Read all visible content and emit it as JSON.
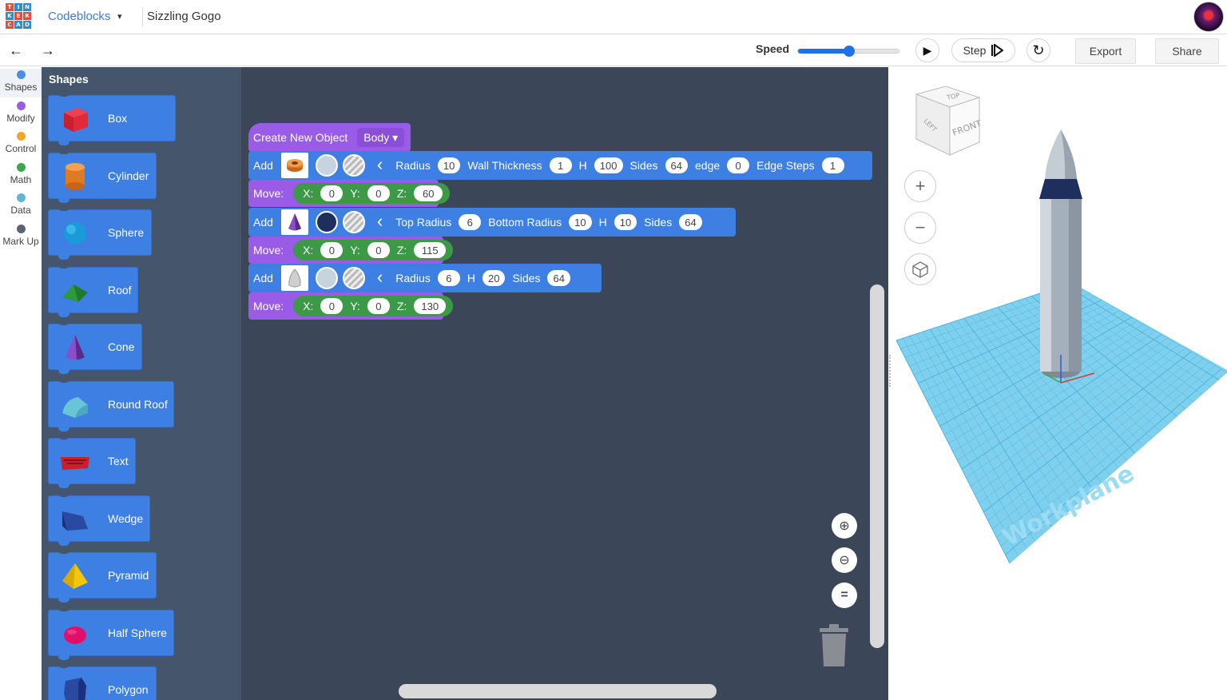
{
  "header": {
    "logo_letters": [
      "T",
      "I",
      "N",
      "K",
      "E",
      "R",
      "C",
      "A",
      "D"
    ],
    "logo_colors": [
      "#e64c3c",
      "#2a8fcf",
      "#2a8fcf",
      "#2a8fcf",
      "#e64c3c",
      "#e64c3c",
      "#e64c3c",
      "#2a8fcf",
      "#2a8fcf"
    ],
    "app_name": "Codeblocks",
    "app_caret": "▾",
    "project_name": "Sizzling Gogo"
  },
  "toolbar": {
    "undo_icon": "←",
    "redo_icon": "→",
    "speed_label": "Speed",
    "speed_value": 0.5,
    "play_icon": "▶",
    "step_label": "Step",
    "step_icon": "⏵|",
    "reset_icon": "↻",
    "export_label": "Export",
    "share_label": "Share"
  },
  "categories": [
    {
      "label": "Shapes",
      "color": "#4a90e2",
      "active": true
    },
    {
      "label": "Modify",
      "color": "#9a5ce6",
      "active": false
    },
    {
      "label": "Control",
      "color": "#f5a623",
      "active": false
    },
    {
      "label": "Math",
      "color": "#3ca64a",
      "active": false
    },
    {
      "label": "Data",
      "color": "#5bb8d8",
      "active": false
    },
    {
      "label": "Mark Up",
      "color": "#5b6472",
      "active": false
    }
  ],
  "flyout": {
    "title": "Shapes",
    "items": [
      {
        "label": "Box",
        "icon": "box-icon"
      },
      {
        "label": "Cylinder",
        "icon": "cylinder-icon"
      },
      {
        "label": "Sphere",
        "icon": "sphere-icon"
      },
      {
        "label": "Roof",
        "icon": "roof-icon"
      },
      {
        "label": "Cone",
        "icon": "cone-icon"
      },
      {
        "label": "Round Roof",
        "icon": "round-roof-icon"
      },
      {
        "label": "Text",
        "icon": "text-shape-icon"
      },
      {
        "label": "Wedge",
        "icon": "wedge-icon"
      },
      {
        "label": "Pyramid",
        "icon": "pyramid-icon"
      },
      {
        "label": "Half Sphere",
        "icon": "half-sphere-icon"
      },
      {
        "label": "Polygon",
        "icon": "polygon-icon"
      }
    ]
  },
  "workspace": {
    "create": {
      "label": "Create New Object",
      "dropdown": "Body"
    },
    "add1": {
      "add": "Add",
      "color": "#c8d3e0",
      "fields": [
        {
          "label": "Radius",
          "value": "10"
        },
        {
          "label": "Wall Thickness",
          "value": "1"
        },
        {
          "label": "H",
          "value": "100"
        },
        {
          "label": "Sides",
          "value": "64"
        },
        {
          "label": "edge",
          "value": "0"
        },
        {
          "label": "Edge Steps",
          "value": "1"
        }
      ]
    },
    "move1": {
      "label": "Move:",
      "x": "0",
      "y": "0",
      "z": "60"
    },
    "add2": {
      "add": "Add",
      "color": "#1e2f5e",
      "fields": [
        {
          "label": "Top Radius",
          "value": "6"
        },
        {
          "label": "Bottom Radius",
          "value": "10"
        },
        {
          "label": "H",
          "value": "10"
        },
        {
          "label": "Sides",
          "value": "64"
        }
      ]
    },
    "move2": {
      "label": "Move:",
      "x": "0",
      "y": "0",
      "z": "115"
    },
    "add3": {
      "add": "Add",
      "color": "#c8d3e0",
      "fields": [
        {
          "label": "Radius",
          "value": "6"
        },
        {
          "label": "H",
          "value": "20"
        },
        {
          "label": "Sides",
          "value": "64"
        }
      ]
    },
    "move3": {
      "label": "Move:",
      "x": "0",
      "y": "0",
      "z": "130"
    },
    "axis_labels": {
      "x": "X:",
      "y": "Y:",
      "z": "Z:"
    },
    "zoom_in_icon": "⊕",
    "zoom_out_icon": "⊖",
    "zoom_reset_icon": "="
  },
  "viewport": {
    "view_cube": {
      "top": "TOP",
      "left": "LEFT",
      "front": "FRONT"
    },
    "zoom_in_icon": "+",
    "zoom_out_icon": "−",
    "home_icon": "cube-icon",
    "workplane_label": "Workplane",
    "grid_color": "#7fd0ee"
  }
}
